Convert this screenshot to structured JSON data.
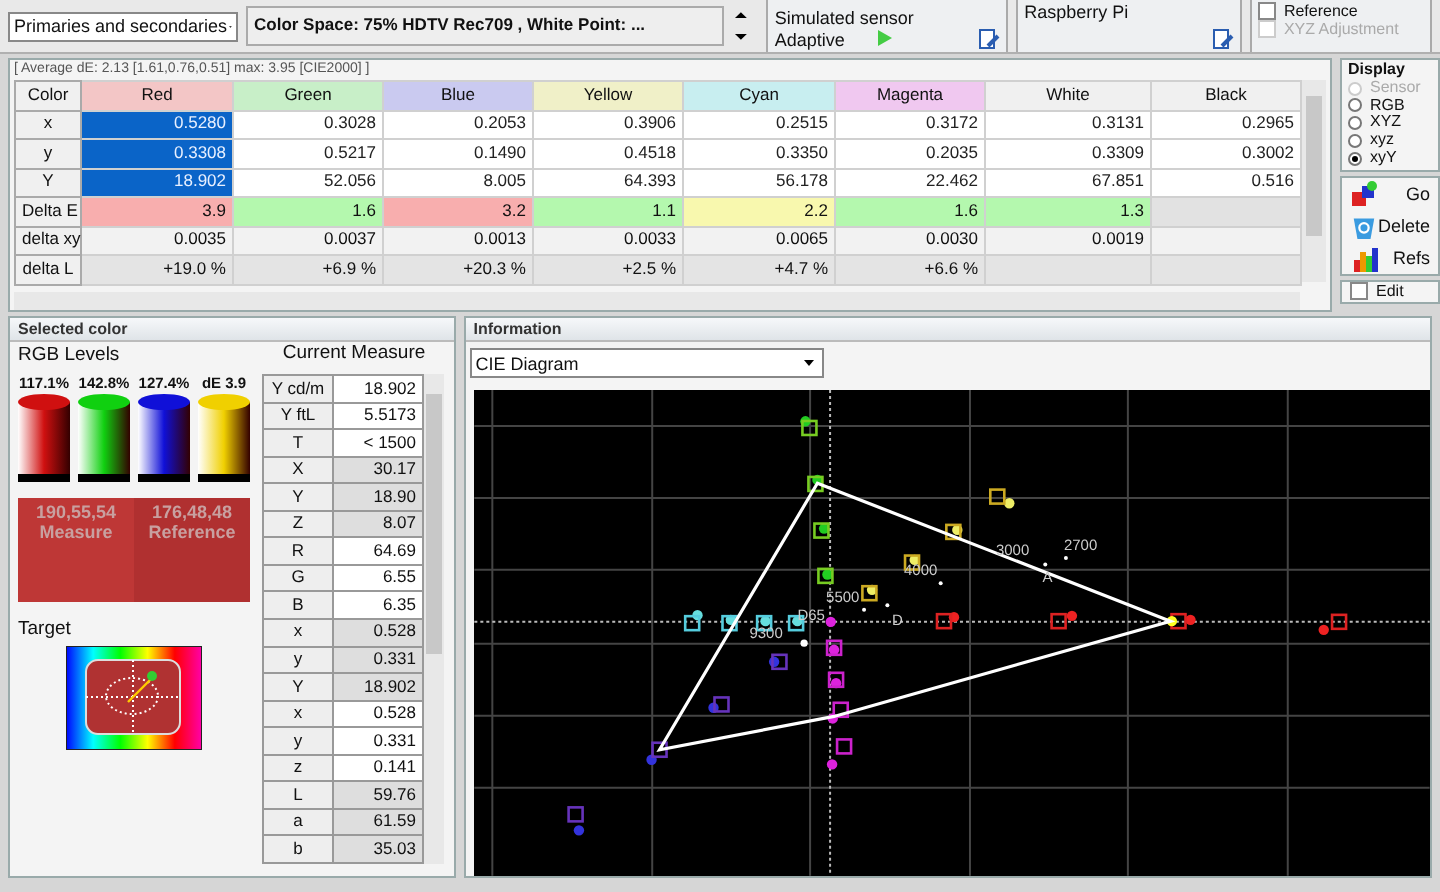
{
  "toolbar": {
    "series_select": "Primaries and secondaries",
    "color_space": "Color Space: 75% HDTV Rec709 , White Point: ...",
    "sensor": {
      "title": "Simulated sensor",
      "mode": "Adaptive"
    },
    "generator": {
      "title": "Raspberry Pi"
    },
    "options": [
      {
        "label": "Reference",
        "checked": false,
        "disabled": false
      },
      {
        "label": "XYZ Adjustment",
        "checked": false,
        "disabled": true
      }
    ]
  },
  "measures": {
    "summary": "[ Average dE: 2.13 [1.61,0.76,0.51] max: 3.95 [CIE2000] ]",
    "corner": "Color",
    "columns": [
      {
        "label": "Red",
        "color": "#f3c6c6"
      },
      {
        "label": "Green",
        "color": "#c8efc8"
      },
      {
        "label": "Blue",
        "color": "#cacaf0"
      },
      {
        "label": "Yellow",
        "color": "#f0f0c8"
      },
      {
        "label": "Cyan",
        "color": "#c8eef0"
      },
      {
        "label": "Magenta",
        "color": "#f0c8f0"
      },
      {
        "label": "White",
        "color": "#f0f0f0"
      },
      {
        "label": "Black",
        "color": "#f0f0f0"
      }
    ],
    "rows": [
      {
        "label": "x",
        "kind": "value",
        "cells": [
          {
            "text": "0.5280",
            "selected": true
          },
          {
            "text": "0.3028",
            "selected": false
          },
          {
            "text": "0.2053",
            "selected": false
          },
          {
            "text": "0.3906",
            "selected": false
          },
          {
            "text": "0.2515",
            "selected": false
          },
          {
            "text": "0.3172",
            "selected": false
          },
          {
            "text": "0.3131",
            "selected": false
          },
          {
            "text": "0.2965",
            "selected": false
          }
        ]
      },
      {
        "label": "y",
        "kind": "value",
        "cells": [
          {
            "text": "0.3308",
            "selected": true
          },
          {
            "text": "0.5217",
            "selected": false
          },
          {
            "text": "0.1490",
            "selected": false
          },
          {
            "text": "0.4518",
            "selected": false
          },
          {
            "text": "0.3350",
            "selected": false
          },
          {
            "text": "0.2035",
            "selected": false
          },
          {
            "text": "0.3309",
            "selected": false
          },
          {
            "text": "0.3002",
            "selected": false
          }
        ]
      },
      {
        "label": "Y",
        "kind": "value",
        "cells": [
          {
            "text": "18.902",
            "selected": true
          },
          {
            "text": "52.056",
            "selected": false
          },
          {
            "text": "8.005",
            "selected": false
          },
          {
            "text": "64.393",
            "selected": false
          },
          {
            "text": "56.178",
            "selected": false
          },
          {
            "text": "22.462",
            "selected": false
          },
          {
            "text": "67.851",
            "selected": false
          },
          {
            "text": "0.516",
            "selected": false
          }
        ]
      },
      {
        "label": "Delta E",
        "kind": "delta",
        "cells": [
          {
            "text": "3.9",
            "color": "#f8aeae"
          },
          {
            "text": "1.6",
            "color": "#b4f8ae"
          },
          {
            "text": "3.2",
            "color": "#f8aeae"
          },
          {
            "text": "1.1",
            "color": "#b4f8ae"
          },
          {
            "text": "2.2",
            "color": "#f8f8ae"
          },
          {
            "text": "1.6",
            "color": "#b4f8ae"
          },
          {
            "text": "1.3",
            "color": "#b4f8ae"
          },
          null
        ]
      },
      {
        "label": "delta xy",
        "kind": "info",
        "cells": [
          "0.0035",
          "0.0037",
          "0.0013",
          "0.0033",
          "0.0065",
          "0.0030",
          "0.0019",
          null
        ]
      },
      {
        "label": "delta L",
        "kind": "info2",
        "cells": [
          "+19.0 %",
          "+6.9 %",
          "+20.3 %",
          "+2.5 %",
          "+4.7 %",
          "+6.6 %",
          null,
          null
        ]
      }
    ]
  },
  "display": {
    "title": "Display",
    "options": [
      {
        "label": "Sensor",
        "selected": false,
        "disabled": true
      },
      {
        "label": "RGB",
        "selected": false,
        "disabled": false
      },
      {
        "label": "XYZ",
        "selected": false,
        "disabled": false
      },
      {
        "label": "xyz",
        "selected": false,
        "disabled": false
      },
      {
        "label": "xyY",
        "selected": true,
        "disabled": false
      }
    ]
  },
  "actions": [
    {
      "label": "Go",
      "kind": "go"
    },
    {
      "label": "Delete",
      "kind": "delete"
    },
    {
      "label": "Refs",
      "kind": "refs"
    }
  ],
  "edit": {
    "label": "Edit",
    "checked": false
  },
  "selected_color": {
    "title": "Selected color",
    "levels_title": "RGB Levels",
    "levels": [
      {
        "label": "117.1%",
        "color": "#d01010"
      },
      {
        "label": "142.8%",
        "color": "#10d010"
      },
      {
        "label": "127.4%",
        "color": "#1010d8"
      },
      {
        "label": "dE 3.9",
        "color": "#f0d000"
      }
    ],
    "swatches": [
      {
        "value": "190,55,54",
        "label": "Measure",
        "color": "#be3736"
      },
      {
        "value": "176,48,48",
        "label": "Reference",
        "color": "#b03030"
      }
    ],
    "target_title": "Target",
    "current_title": "Current Measure",
    "current_rows": [
      {
        "label": "Y cd/m",
        "value": "18.902",
        "shaded": false
      },
      {
        "label": "Y ftL",
        "value": "5.5173",
        "shaded": false
      },
      {
        "label": "T",
        "value": "< 1500",
        "shaded": false
      },
      {
        "label": "X",
        "value": "30.17",
        "shaded": true
      },
      {
        "label": "Y",
        "value": "18.90",
        "shaded": true
      },
      {
        "label": "Z",
        "value": "8.07",
        "shaded": true
      },
      {
        "label": "R",
        "value": "64.69",
        "shaded": false
      },
      {
        "label": "G",
        "value": "6.55",
        "shaded": false
      },
      {
        "label": "B",
        "value": "6.35",
        "shaded": false
      },
      {
        "label": "x",
        "value": "0.528",
        "shaded": true
      },
      {
        "label": "y",
        "value": "0.331",
        "shaded": true
      },
      {
        "label": "Y",
        "value": "18.902",
        "shaded": true
      },
      {
        "label": "x",
        "value": "0.528",
        "shaded": false
      },
      {
        "label": "y",
        "value": "0.331",
        "shaded": false
      },
      {
        "label": "z",
        "value": "0.141",
        "shaded": false
      },
      {
        "label": "L",
        "value": "59.76",
        "shaded": true
      },
      {
        "label": "a",
        "value": "61.59",
        "shaded": true
      },
      {
        "label": "b",
        "value": "35.03",
        "shaded": true
      }
    ]
  },
  "information": {
    "title": "Information",
    "view": "CIE Diagram",
    "labels": [
      "2700",
      "3000",
      "4000",
      "5500",
      "D65",
      "9300",
      "A",
      "D"
    ]
  }
}
